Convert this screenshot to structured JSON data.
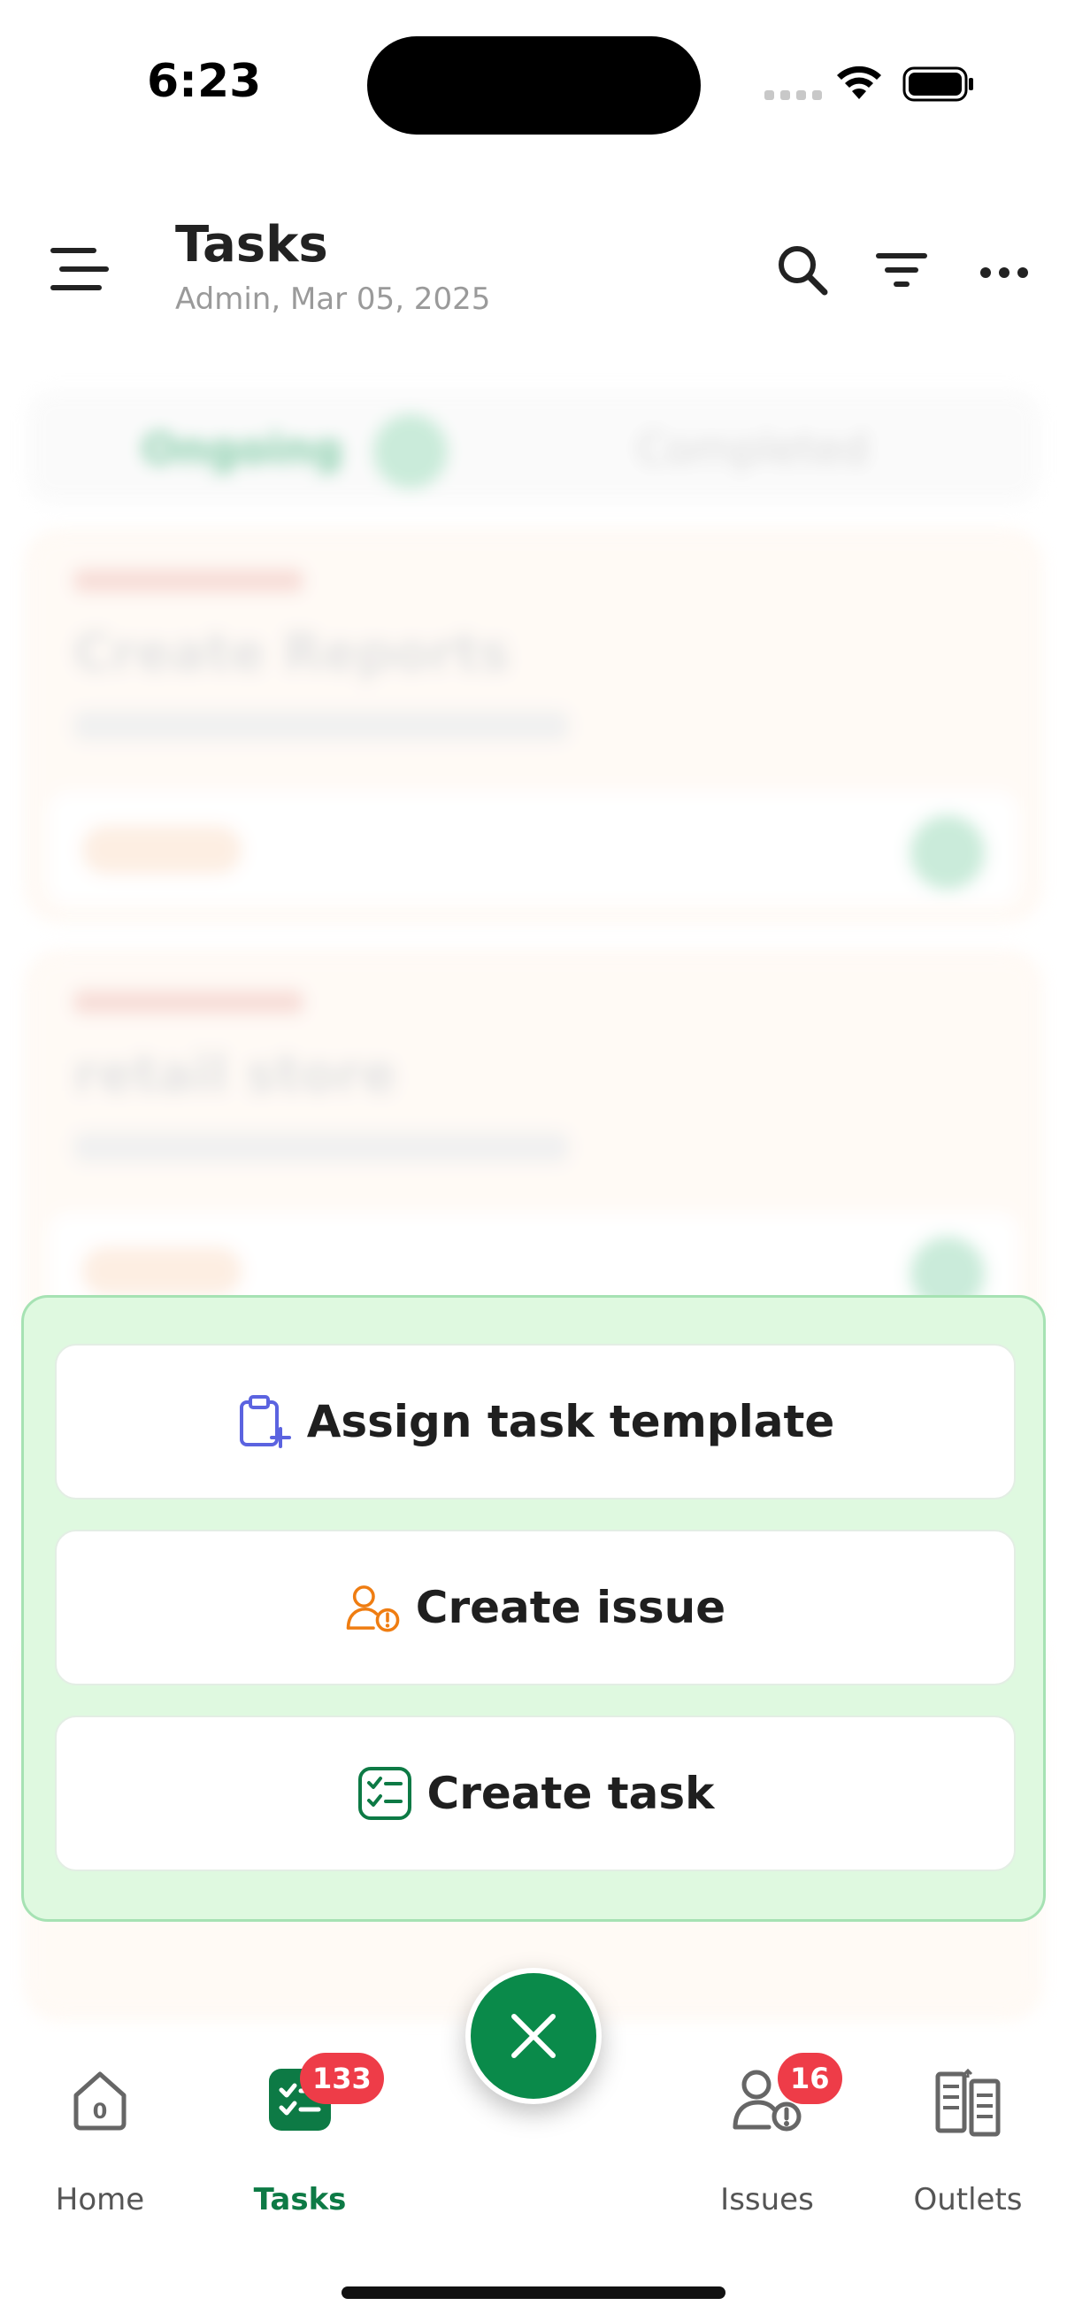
{
  "status_bar": {
    "time": "6:23"
  },
  "header": {
    "title": "Tasks",
    "subtitle": "Admin, Mar 05, 2025",
    "icons": [
      "menu-icon",
      "search-icon",
      "filter-icon",
      "more-icon"
    ]
  },
  "background": {
    "tabs": [
      {
        "label": "Ongoing"
      },
      {
        "label": "Completed"
      }
    ],
    "cards": [
      {
        "title": "Create Reports"
      },
      {
        "title": "retail store"
      }
    ]
  },
  "action_sheet": {
    "items": [
      {
        "label": "Assign task template",
        "icon": "clipboard-plus-icon",
        "icon_color": "#5b63e0"
      },
      {
        "label": "Create issue",
        "icon": "user-alert-icon",
        "icon_color": "#ef7d12"
      },
      {
        "label": "Create task",
        "icon": "checklist-icon",
        "icon_color": "#0d7a45"
      }
    ]
  },
  "bottom_nav": {
    "items": [
      {
        "label": "Home",
        "icon": "home-icon",
        "icon_text": "0"
      },
      {
        "label": "Tasks",
        "icon": "tasks-icon",
        "badge": "133",
        "active": true
      },
      {
        "label": "Issues",
        "icon": "issues-icon",
        "badge": "16"
      },
      {
        "label": "Outlets",
        "icon": "outlets-icon"
      }
    ],
    "fab_icon": "close-icon"
  },
  "colors": {
    "primary": "#0a8a4a",
    "sheet_bg": "#dff9e0",
    "badge": "#ee3c48"
  }
}
